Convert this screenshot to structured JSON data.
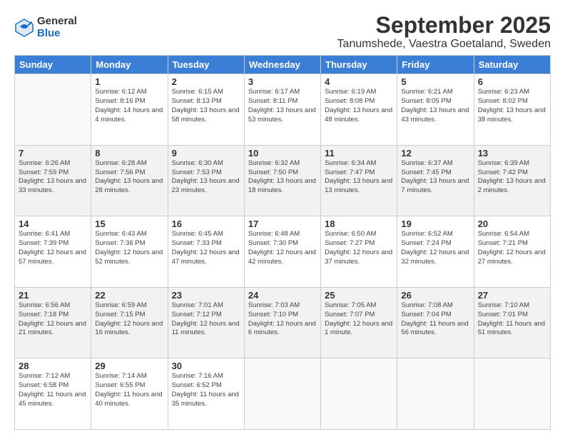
{
  "logo": {
    "general": "General",
    "blue": "Blue"
  },
  "title": "September 2025",
  "subtitle": "Tanumshede, Vaestra Goetaland, Sweden",
  "days_header": [
    "Sunday",
    "Monday",
    "Tuesday",
    "Wednesday",
    "Thursday",
    "Friday",
    "Saturday"
  ],
  "weeks": [
    [
      {
        "num": "",
        "info": ""
      },
      {
        "num": "1",
        "info": "Sunrise: 6:12 AM\nSunset: 8:16 PM\nDaylight: 14 hours\nand 4 minutes."
      },
      {
        "num": "2",
        "info": "Sunrise: 6:15 AM\nSunset: 8:13 PM\nDaylight: 13 hours\nand 58 minutes."
      },
      {
        "num": "3",
        "info": "Sunrise: 6:17 AM\nSunset: 8:11 PM\nDaylight: 13 hours\nand 53 minutes."
      },
      {
        "num": "4",
        "info": "Sunrise: 6:19 AM\nSunset: 8:08 PM\nDaylight: 13 hours\nand 48 minutes."
      },
      {
        "num": "5",
        "info": "Sunrise: 6:21 AM\nSunset: 8:05 PM\nDaylight: 13 hours\nand 43 minutes."
      },
      {
        "num": "6",
        "info": "Sunrise: 6:23 AM\nSunset: 8:02 PM\nDaylight: 13 hours\nand 38 minutes."
      }
    ],
    [
      {
        "num": "7",
        "info": "Sunrise: 6:26 AM\nSunset: 7:59 PM\nDaylight: 13 hours\nand 33 minutes."
      },
      {
        "num": "8",
        "info": "Sunrise: 6:28 AM\nSunset: 7:56 PM\nDaylight: 13 hours\nand 28 minutes."
      },
      {
        "num": "9",
        "info": "Sunrise: 6:30 AM\nSunset: 7:53 PM\nDaylight: 13 hours\nand 23 minutes."
      },
      {
        "num": "10",
        "info": "Sunrise: 6:32 AM\nSunset: 7:50 PM\nDaylight: 13 hours\nand 18 minutes."
      },
      {
        "num": "11",
        "info": "Sunrise: 6:34 AM\nSunset: 7:47 PM\nDaylight: 13 hours\nand 13 minutes."
      },
      {
        "num": "12",
        "info": "Sunrise: 6:37 AM\nSunset: 7:45 PM\nDaylight: 13 hours\nand 7 minutes."
      },
      {
        "num": "13",
        "info": "Sunrise: 6:39 AM\nSunset: 7:42 PM\nDaylight: 13 hours\nand 2 minutes."
      }
    ],
    [
      {
        "num": "14",
        "info": "Sunrise: 6:41 AM\nSunset: 7:39 PM\nDaylight: 12 hours\nand 57 minutes."
      },
      {
        "num": "15",
        "info": "Sunrise: 6:43 AM\nSunset: 7:36 PM\nDaylight: 12 hours\nand 52 minutes."
      },
      {
        "num": "16",
        "info": "Sunrise: 6:45 AM\nSunset: 7:33 PM\nDaylight: 12 hours\nand 47 minutes."
      },
      {
        "num": "17",
        "info": "Sunrise: 6:48 AM\nSunset: 7:30 PM\nDaylight: 12 hours\nand 42 minutes."
      },
      {
        "num": "18",
        "info": "Sunrise: 6:50 AM\nSunset: 7:27 PM\nDaylight: 12 hours\nand 37 minutes."
      },
      {
        "num": "19",
        "info": "Sunrise: 6:52 AM\nSunset: 7:24 PM\nDaylight: 12 hours\nand 32 minutes."
      },
      {
        "num": "20",
        "info": "Sunrise: 6:54 AM\nSunset: 7:21 PM\nDaylight: 12 hours\nand 27 minutes."
      }
    ],
    [
      {
        "num": "21",
        "info": "Sunrise: 6:56 AM\nSunset: 7:18 PM\nDaylight: 12 hours\nand 21 minutes."
      },
      {
        "num": "22",
        "info": "Sunrise: 6:59 AM\nSunset: 7:15 PM\nDaylight: 12 hours\nand 16 minutes."
      },
      {
        "num": "23",
        "info": "Sunrise: 7:01 AM\nSunset: 7:12 PM\nDaylight: 12 hours\nand 11 minutes."
      },
      {
        "num": "24",
        "info": "Sunrise: 7:03 AM\nSunset: 7:10 PM\nDaylight: 12 hours\nand 6 minutes."
      },
      {
        "num": "25",
        "info": "Sunrise: 7:05 AM\nSunset: 7:07 PM\nDaylight: 12 hours\nand 1 minute."
      },
      {
        "num": "26",
        "info": "Sunrise: 7:08 AM\nSunset: 7:04 PM\nDaylight: 11 hours\nand 56 minutes."
      },
      {
        "num": "27",
        "info": "Sunrise: 7:10 AM\nSunset: 7:01 PM\nDaylight: 11 hours\nand 51 minutes."
      }
    ],
    [
      {
        "num": "28",
        "info": "Sunrise: 7:12 AM\nSunset: 6:58 PM\nDaylight: 11 hours\nand 45 minutes."
      },
      {
        "num": "29",
        "info": "Sunrise: 7:14 AM\nSunset: 6:55 PM\nDaylight: 11 hours\nand 40 minutes."
      },
      {
        "num": "30",
        "info": "Sunrise: 7:16 AM\nSunset: 6:52 PM\nDaylight: 11 hours\nand 35 minutes."
      },
      {
        "num": "",
        "info": ""
      },
      {
        "num": "",
        "info": ""
      },
      {
        "num": "",
        "info": ""
      },
      {
        "num": "",
        "info": ""
      }
    ]
  ]
}
